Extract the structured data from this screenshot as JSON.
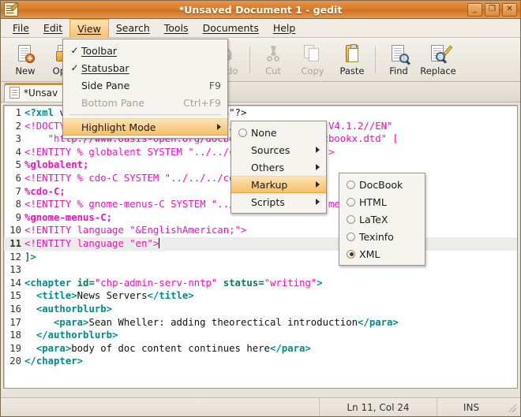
{
  "window": {
    "title": "*Unsaved Document 1 - gedit",
    "icon": "gedit-notepad-icon",
    "buttons": {
      "minimize": "_",
      "maximize": "❐",
      "close": "✕"
    }
  },
  "menubar": {
    "items": [
      {
        "label": "File",
        "mnemonic": "F"
      },
      {
        "label": "Edit",
        "mnemonic": "E"
      },
      {
        "label": "View",
        "mnemonic": "V"
      },
      {
        "label": "Search",
        "mnemonic": "S"
      },
      {
        "label": "Tools",
        "mnemonic": "T"
      },
      {
        "label": "Documents",
        "mnemonic": "D"
      },
      {
        "label": "Help",
        "mnemonic": "H"
      }
    ],
    "open_item": "View"
  },
  "toolbar": {
    "items": [
      {
        "label": "New",
        "icon": "new-document-icon",
        "enabled": true
      },
      {
        "label": "Open",
        "icon": "open-folder-icon",
        "enabled": true
      },
      {
        "label": "Redo",
        "icon": "redo-arrow-icon",
        "enabled": false
      },
      {
        "label": "Cut",
        "icon": "scissors-icon",
        "enabled": false
      },
      {
        "label": "Copy",
        "icon": "copy-pages-icon",
        "enabled": false
      },
      {
        "label": "Paste",
        "icon": "clipboard-icon",
        "enabled": true
      },
      {
        "label": "Find",
        "icon": "magnifier-icon",
        "enabled": true
      },
      {
        "label": "Replace",
        "icon": "find-replace-icon",
        "enabled": true
      }
    ]
  },
  "tab": {
    "label": "*Unsav",
    "icon": "text-document-icon"
  },
  "view_menu": {
    "items": [
      {
        "label": "Toolbar",
        "mnemonic": "T",
        "check": "✓",
        "accel": "",
        "enabled": true,
        "highlighted": false,
        "submenu": false
      },
      {
        "label": "Statusbar",
        "mnemonic": "S",
        "check": "✓",
        "accel": "",
        "enabled": true,
        "highlighted": false,
        "submenu": false
      },
      {
        "label": "Side Pane",
        "mnemonic": "P",
        "check": "",
        "accel": "F9",
        "enabled": true,
        "highlighted": false,
        "submenu": false
      },
      {
        "label": "Bottom Pane",
        "mnemonic": "B",
        "check": "",
        "accel": "Ctrl+F9",
        "enabled": false,
        "highlighted": false,
        "submenu": false
      },
      {
        "separator": true
      },
      {
        "label": "Highlight Mode",
        "mnemonic": "H",
        "check": "",
        "accel": "",
        "enabled": true,
        "highlighted": true,
        "submenu": true
      }
    ]
  },
  "highlight_menu": {
    "items": [
      {
        "label": "None",
        "radio": true,
        "selected": false,
        "submenu": false,
        "highlighted": false
      },
      {
        "label": "Sources",
        "radio": false,
        "selected": false,
        "submenu": true,
        "highlighted": false
      },
      {
        "label": "Others",
        "radio": false,
        "selected": false,
        "submenu": true,
        "highlighted": false
      },
      {
        "label": "Markup",
        "radio": false,
        "selected": false,
        "submenu": true,
        "highlighted": true
      },
      {
        "label": "Scripts",
        "radio": false,
        "selected": false,
        "submenu": true,
        "highlighted": false
      }
    ]
  },
  "markup_menu": {
    "items": [
      {
        "label": "DocBook",
        "selected": false
      },
      {
        "label": "HTML",
        "selected": false
      },
      {
        "label": "LaTeX",
        "selected": false
      },
      {
        "label": "Texinfo",
        "selected": false
      },
      {
        "label": "XML",
        "selected": true
      }
    ]
  },
  "statusbar": {
    "left": "",
    "position": "Ln 11, Col 24",
    "insert_mode": "INS",
    "grip": "resize-grip-icon"
  },
  "editor": {
    "active_line": 11,
    "lines": [
      {
        "n": 1,
        "parts": [
          {
            "t": "tag",
            "s": "<?xml"
          },
          {
            "t": "plain",
            "s": " version=\"1.0\" encoding=\"UTF-8\"?>"
          }
        ]
      },
      {
        "n": 2,
        "parts": [
          {
            "t": "doct",
            "s": "<!DOCTYPE chapter PUBLIC \"-//OASIS//DTD DocBook XML V4.1.2//EN\""
          }
        ]
      },
      {
        "n": 3,
        "parts": [
          {
            "t": "doct",
            "s": "    \"http://www.oasis-open.org/docbook/xml/4.1.2/docbookx.dtd\" ["
          }
        ]
      },
      {
        "n": 4,
        "parts": [
          {
            "t": "doct",
            "s": "<!ENTITY % globalent SYSTEM \"../../common/globalent\">"
          }
        ]
      },
      {
        "n": 5,
        "parts": [
          {
            "t": "ent",
            "s": "%globalent;"
          }
        ]
      },
      {
        "n": 6,
        "parts": [
          {
            "t": "doct",
            "s": "<!ENTITY % cdo-C SYSTEM \"../../../common/cdo-C\">"
          }
        ]
      },
      {
        "n": 7,
        "parts": [
          {
            "t": "ent",
            "s": "%cdo-C;"
          }
        ]
      },
      {
        "n": 8,
        "parts": [
          {
            "t": "doct",
            "s": "<!ENTITY % gnome-menus-C SYSTEM \"../../common/gnome-menus-C\">"
          }
        ]
      },
      {
        "n": 9,
        "parts": [
          {
            "t": "ent",
            "s": "%gnome-menus-C;"
          }
        ]
      },
      {
        "n": 10,
        "parts": [
          {
            "t": "doct",
            "s": "<!ENTITY language \"&EnglishAmerican;\">"
          }
        ]
      },
      {
        "n": 11,
        "parts": [
          {
            "t": "doct",
            "s": "<!ENTITY language \"en\">"
          },
          {
            "t": "caret",
            "s": ""
          }
        ]
      },
      {
        "n": 12,
        "parts": [
          {
            "t": "plain",
            "s": "]"
          },
          {
            "t": "tag",
            "s": ">"
          }
        ]
      },
      {
        "n": 13,
        "parts": []
      },
      {
        "n": 14,
        "parts": [
          {
            "t": "tag",
            "s": "<chapter "
          },
          {
            "t": "attr",
            "s": "id="
          },
          {
            "t": "str",
            "s": "\"chp-admin-serv-nntp\""
          },
          {
            "t": "plain",
            "s": " "
          },
          {
            "t": "attr",
            "s": "status="
          },
          {
            "t": "str",
            "s": "\"writing\""
          },
          {
            "t": "tag",
            "s": ">"
          }
        ]
      },
      {
        "n": 15,
        "parts": [
          {
            "t": "plain",
            "s": "  "
          },
          {
            "t": "tag",
            "s": "<title>"
          },
          {
            "t": "plain",
            "s": "News Servers"
          },
          {
            "t": "tag",
            "s": "</title>"
          }
        ]
      },
      {
        "n": 16,
        "parts": [
          {
            "t": "plain",
            "s": "  "
          },
          {
            "t": "tag",
            "s": "<authorblurb>"
          }
        ]
      },
      {
        "n": 17,
        "parts": [
          {
            "t": "plain",
            "s": "     "
          },
          {
            "t": "tag",
            "s": "<para>"
          },
          {
            "t": "plain",
            "s": "Sean Wheller: adding theorectical introduction"
          },
          {
            "t": "tag",
            "s": "</para>"
          }
        ]
      },
      {
        "n": 18,
        "parts": [
          {
            "t": "plain",
            "s": "  "
          },
          {
            "t": "tag",
            "s": "</authorblurb>"
          }
        ]
      },
      {
        "n": 19,
        "parts": [
          {
            "t": "plain",
            "s": "  "
          },
          {
            "t": "tag",
            "s": "<para>"
          },
          {
            "t": "plain",
            "s": "body of doc content continues here"
          },
          {
            "t": "tag",
            "s": "</para>"
          }
        ]
      },
      {
        "n": 20,
        "parts": [
          {
            "t": "tag",
            "s": "</chapter>"
          }
        ]
      }
    ]
  },
  "colors": {
    "titlebar": "#d97b26",
    "menu_highlight": "#f6c068",
    "tag": "#008b8b",
    "doctype": "#f012be",
    "attr": "#0b7a5a",
    "active_line": "#ececea"
  }
}
